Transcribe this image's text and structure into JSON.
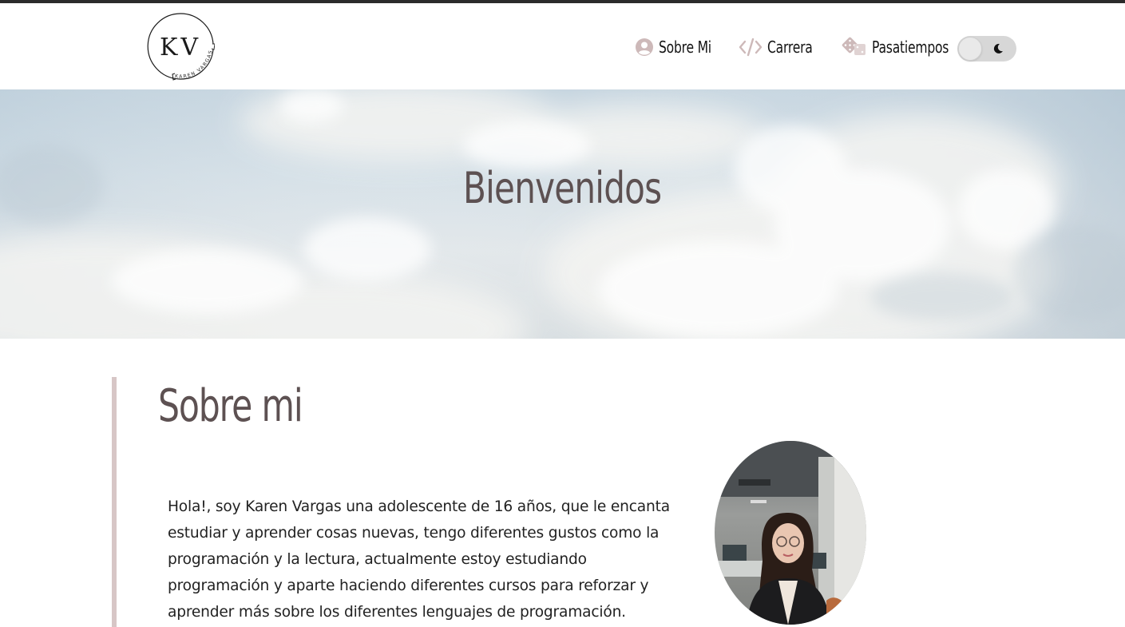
{
  "logo": {
    "initials": "KV",
    "subtitle": "KAREN VARGAS",
    "icon": "monogram-logo"
  },
  "nav": {
    "items": [
      {
        "label": "Sobre Mi",
        "icon": "user-circle-icon"
      },
      {
        "label": "Carrera",
        "icon": "code-icon"
      },
      {
        "label": "Pasatiempos",
        "icon": "dice-icon"
      }
    ],
    "theme_toggle": {
      "icon": "moon-icon",
      "state": "light"
    }
  },
  "hero": {
    "title": "Bienvenidos",
    "background": "cloudy-sky-image"
  },
  "about": {
    "title": "Sobre mi",
    "text": "Hola!, soy Karen Vargas una adolescente de 16 años, que le encanta estudiar y aprender cosas nuevas, tengo diferentes gustos como la programación y la lectura, actualmente estoy estudiando programación y aparte haciendo diferentes cursos para reforzar y aprender más sobre los diferentes lenguajes de programación.",
    "lines": [
      "Hola!, soy Karen Vargas una adolescente de 16 años, que le encanta",
      "estudiar y aprender cosas nuevas, tengo diferentes gustos como la",
      "programación y la lectura, actualmente estoy estudiando",
      "programación y aparte haciendo diferentes cursos para reforzar y",
      "aprender más sobre los diferentes lenguajes de programación."
    ],
    "photo": "profile-photo"
  },
  "colors": {
    "accent": "#d7c6c6",
    "heading": "#5d5152",
    "icon": "#cdb9b9",
    "topline": "#2b2b2b"
  }
}
